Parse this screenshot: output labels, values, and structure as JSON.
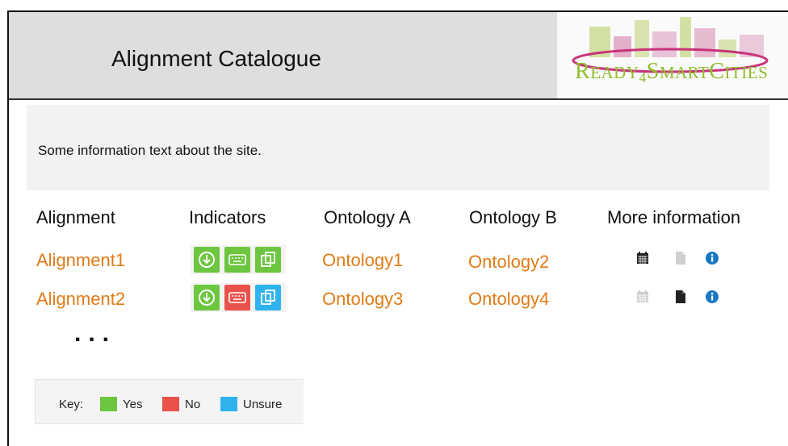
{
  "header": {
    "title": "Alignment Catalogue",
    "logo_text": {
      "r": "R",
      "eady": "EADY",
      "four": "4",
      "s": "S",
      "mart": "MART",
      "c": "C",
      "ities": "ITIES"
    }
  },
  "info": {
    "text": "Some information text about the site."
  },
  "table": {
    "headers": [
      "Alignment",
      "Indicators",
      "Ontology A",
      "Ontology B",
      "More information"
    ],
    "rows": [
      {
        "alignment": "Alignment1",
        "ontology_a": "Ontology1",
        "ontology_b": "Ontology2",
        "indicators": [
          "green",
          "green",
          "green"
        ],
        "more_info": {
          "calendar": "active",
          "document": "inactive",
          "info": "active"
        }
      },
      {
        "alignment": "Alignment2",
        "ontology_a": "Ontology3",
        "ontology_b": "Ontology4",
        "indicators": [
          "green",
          "red",
          "blue"
        ],
        "more_info": {
          "calendar": "inactive",
          "document": "active",
          "info": "active"
        }
      }
    ],
    "ellipsis": "..."
  },
  "key": {
    "label": "Key:",
    "items": [
      {
        "label": "Yes",
        "color": "#6cc63f"
      },
      {
        "label": "No",
        "color": "#e8524b"
      },
      {
        "label": "Unsure",
        "color": "#2eb3ee"
      }
    ]
  },
  "colors": {
    "link": "#e07b17",
    "yes": "#6cc63f",
    "no": "#e8524b",
    "unsure": "#2eb3ee",
    "info_icon": "#1a78c2"
  }
}
